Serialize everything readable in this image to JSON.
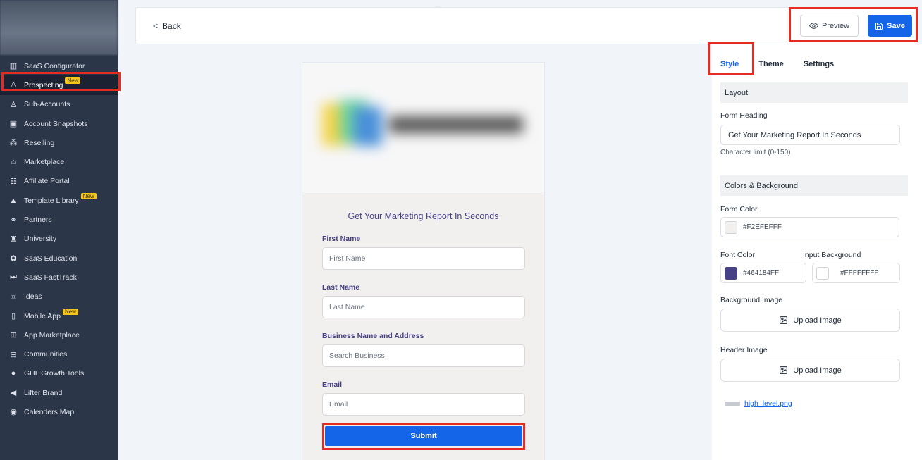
{
  "sidebar": {
    "items": [
      {
        "label": "SaaS Configurator",
        "icon": "chart-icon",
        "new": false
      },
      {
        "label": "Prospecting",
        "icon": "users-icon",
        "new": true
      },
      {
        "label": "Sub-Accounts",
        "icon": "user-icon",
        "new": false
      },
      {
        "label": "Account Snapshots",
        "icon": "snapshot-icon",
        "new": false
      },
      {
        "label": "Reselling",
        "icon": "reselling-icon",
        "new": false
      },
      {
        "label": "Marketplace",
        "icon": "bag-icon",
        "new": false
      },
      {
        "label": "Affiliate Portal",
        "icon": "group-icon",
        "new": false
      },
      {
        "label": "Template Library",
        "icon": "template-icon",
        "new": true
      },
      {
        "label": "Partners",
        "icon": "handshake-icon",
        "new": false
      },
      {
        "label": "University",
        "icon": "graduation-icon",
        "new": false
      },
      {
        "label": "SaaS Education",
        "icon": "education-icon",
        "new": false
      },
      {
        "label": "SaaS FastTrack",
        "icon": "fast-forward-icon",
        "new": false
      },
      {
        "label": "Ideas",
        "icon": "lightbulb-icon",
        "new": false
      },
      {
        "label": "Mobile App",
        "icon": "mobile-icon",
        "new": true
      },
      {
        "label": "App Marketplace",
        "icon": "grid-icon",
        "new": false
      },
      {
        "label": "Communities",
        "icon": "community-icon",
        "new": false
      },
      {
        "label": "GHL Growth Tools",
        "icon": "circle-icon",
        "new": false
      },
      {
        "label": "Lifter Brand",
        "icon": "megaphone-icon",
        "new": false
      },
      {
        "label": "Calenders Map",
        "icon": "calendar-icon",
        "new": false
      }
    ],
    "new_badge": "New"
  },
  "topbar": {
    "back_label": "Back",
    "preview_label": "Preview",
    "save_label": "Save"
  },
  "form_preview": {
    "heading": "Get Your Marketing Report In Seconds",
    "fields": [
      {
        "label": "First Name",
        "placeholder": "First Name"
      },
      {
        "label": "Last Name",
        "placeholder": "Last Name"
      },
      {
        "label": "Business Name and Address",
        "placeholder": "Search Business"
      },
      {
        "label": "Email",
        "placeholder": "Email"
      }
    ],
    "submit_label": "Submit",
    "background_color": "#F2EFEF",
    "font_color": "#464184"
  },
  "right_panel": {
    "tabs": [
      "Style",
      "Theme",
      "Settings"
    ],
    "active_tab": "Style",
    "layout_section": "Layout",
    "form_heading_label": "Form Heading",
    "form_heading_value": "Get Your Marketing Report In Seconds",
    "char_limit": "Character limit (0-150)",
    "colors_section": "Colors & Background",
    "form_color_label": "Form Color",
    "form_color_value": "#F2EFEFFF",
    "font_color_label": "Font Color",
    "font_color_value": "#464184FF",
    "input_bg_label": "Input Background",
    "input_bg_value": "#FFFFFFFF",
    "bg_image_label": "Background Image",
    "upload_label": "Upload Image",
    "header_image_label": "Header Image",
    "file_name": "high_level.png"
  },
  "colors": {
    "accent": "#1565e8",
    "highlight": "#e52b22",
    "sidebar_bg": "#2b3649"
  }
}
